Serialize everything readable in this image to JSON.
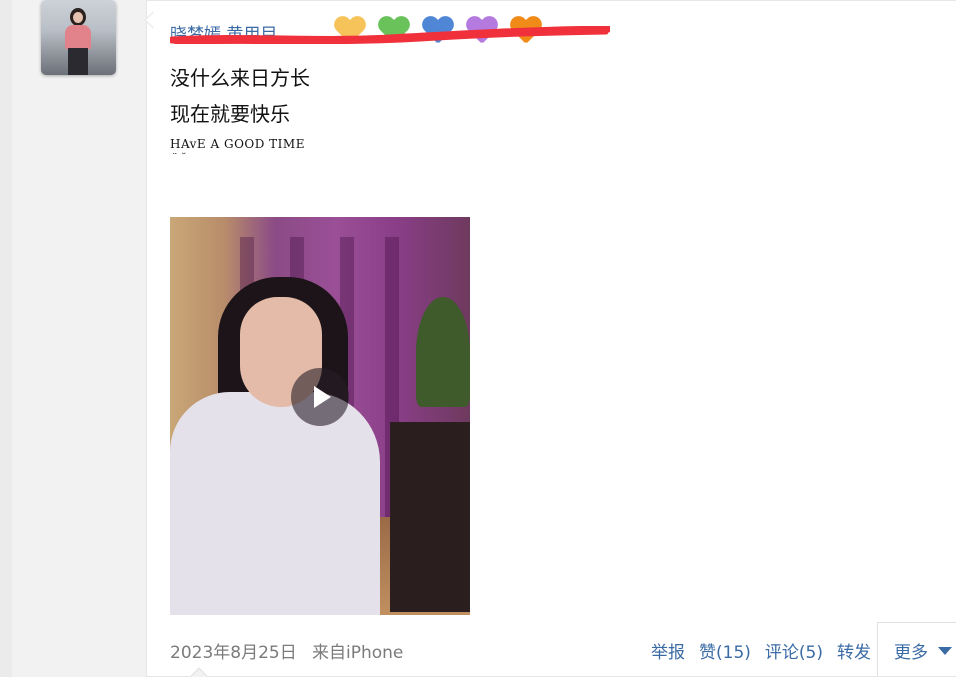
{
  "post": {
    "author_visible": "晓梦嫣    黄用目",
    "line1": "没什么来日方长",
    "line2": "现在就要快乐",
    "tagline": "HAvE A GOOD TIME",
    "tagline_emote": "¨ ˘",
    "hearts": [
      "#f6c35a",
      "#69c25a",
      "#4f86d6",
      "#b57ae0",
      "#f08a18"
    ],
    "redaction_color": "#f0303a"
  },
  "video": {
    "play_icon": "play-icon"
  },
  "footer": {
    "date": "2023年8月25日",
    "source": "来自iPhone",
    "report": "举报",
    "like": "赞(15)",
    "comment": "评论(5)",
    "repost": "转发",
    "more": "更多"
  },
  "colors": {
    "link": "#3b6ba5",
    "meta": "#7b7b7b"
  }
}
